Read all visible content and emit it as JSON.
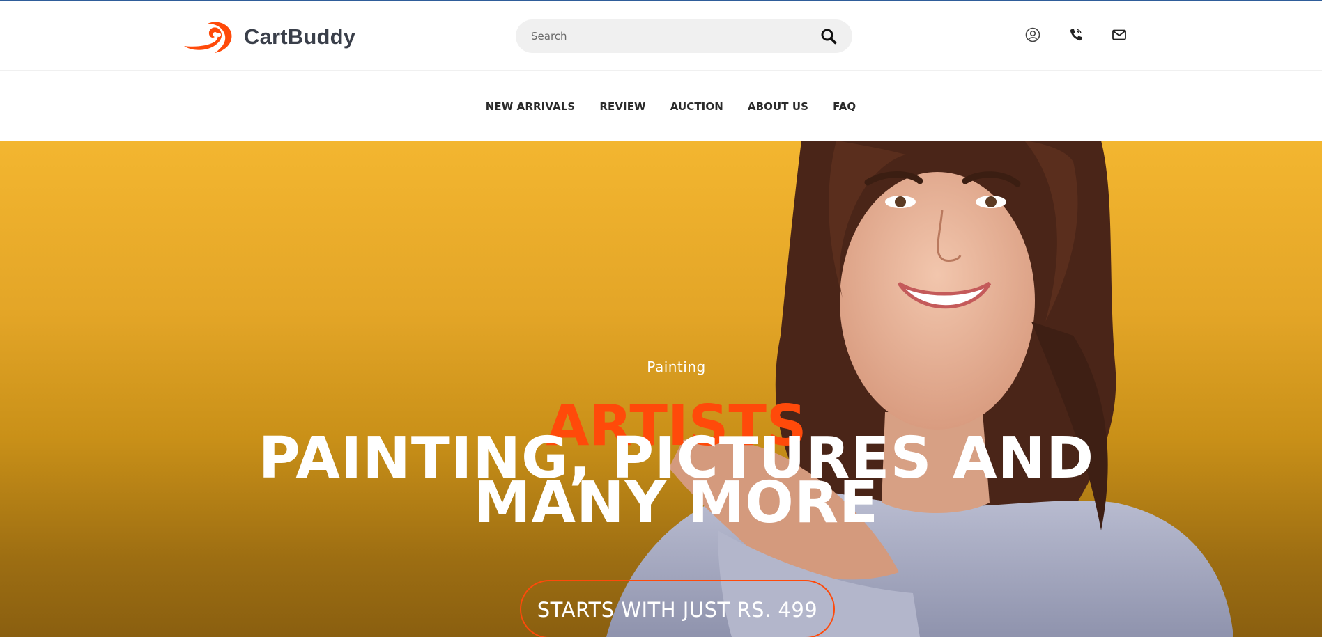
{
  "header": {
    "brand_name": "CartBuddy",
    "search": {
      "placeholder": "Search"
    },
    "icons": [
      "user-icon",
      "phone-icon",
      "mail-icon"
    ]
  },
  "nav": {
    "items": [
      {
        "label": "NEW ARRIVALS"
      },
      {
        "label": "REVIEW"
      },
      {
        "label": "AUCTION"
      },
      {
        "label": "ABOUT US"
      },
      {
        "label": "FAQ"
      }
    ]
  },
  "hero": {
    "eyebrow": "Painting",
    "accent": "ARTISTS",
    "title_line1": "PAINTING, PICTURES AND",
    "title_line2": "MANY MORE",
    "cta_label": "STARTS WITH JUST RS. 499"
  },
  "colors": {
    "brand_orange": "#ff4a0a",
    "hero_yellow": "#f3b630",
    "text_dark": "#2b2b2b",
    "top_rule": "#2f5d9a"
  }
}
